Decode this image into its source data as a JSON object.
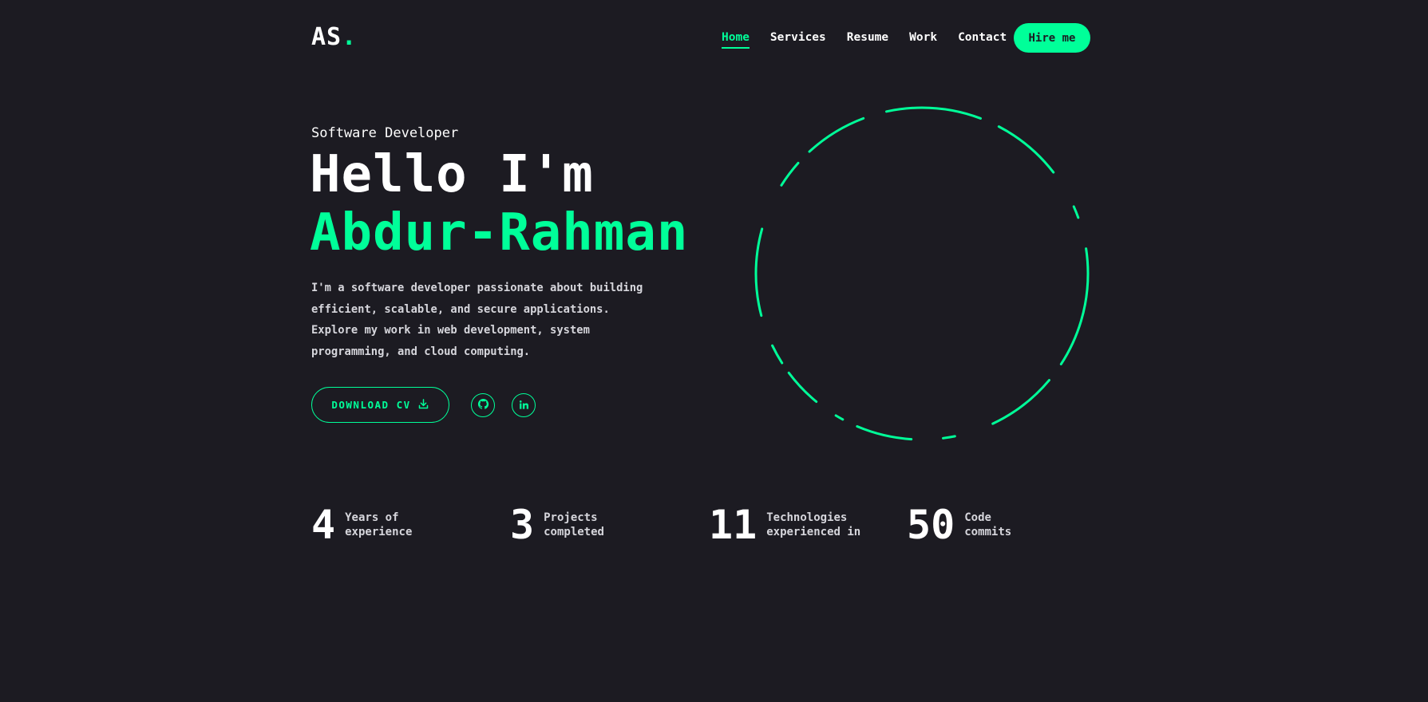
{
  "header": {
    "logo_text": "AS",
    "logo_dot": ".",
    "nav": [
      "Home",
      "Services",
      "Resume",
      "Work",
      "Contact"
    ],
    "hire_label": "Hire me"
  },
  "hero": {
    "subtitle": "Software Developer",
    "greeting": "Hello I'm",
    "name": "Abdur-Rahman",
    "description_lines": [
      "I'm a software developer passionate about building",
      "efficient, scalable, and secure applications.",
      "Explore my work in web development, system",
      "programming, and cloud computing."
    ],
    "cv_label": "DOWNLOAD CV",
    "socials": [
      "github-icon",
      "linkedin-icon"
    ]
  },
  "stats": [
    {
      "number": "4",
      "label_lines": [
        "Years of",
        "experience"
      ]
    },
    {
      "number": "3",
      "label_lines": [
        "Projects",
        "completed"
      ]
    },
    {
      "number": "11",
      "label_lines": [
        "Technologies",
        "experienced in"
      ]
    },
    {
      "number": "50",
      "label_lines": [
        "Code",
        "commits"
      ]
    }
  ],
  "colors": {
    "background": "#1c1b22",
    "accent": "#00ff99",
    "text": "#ffffff"
  }
}
